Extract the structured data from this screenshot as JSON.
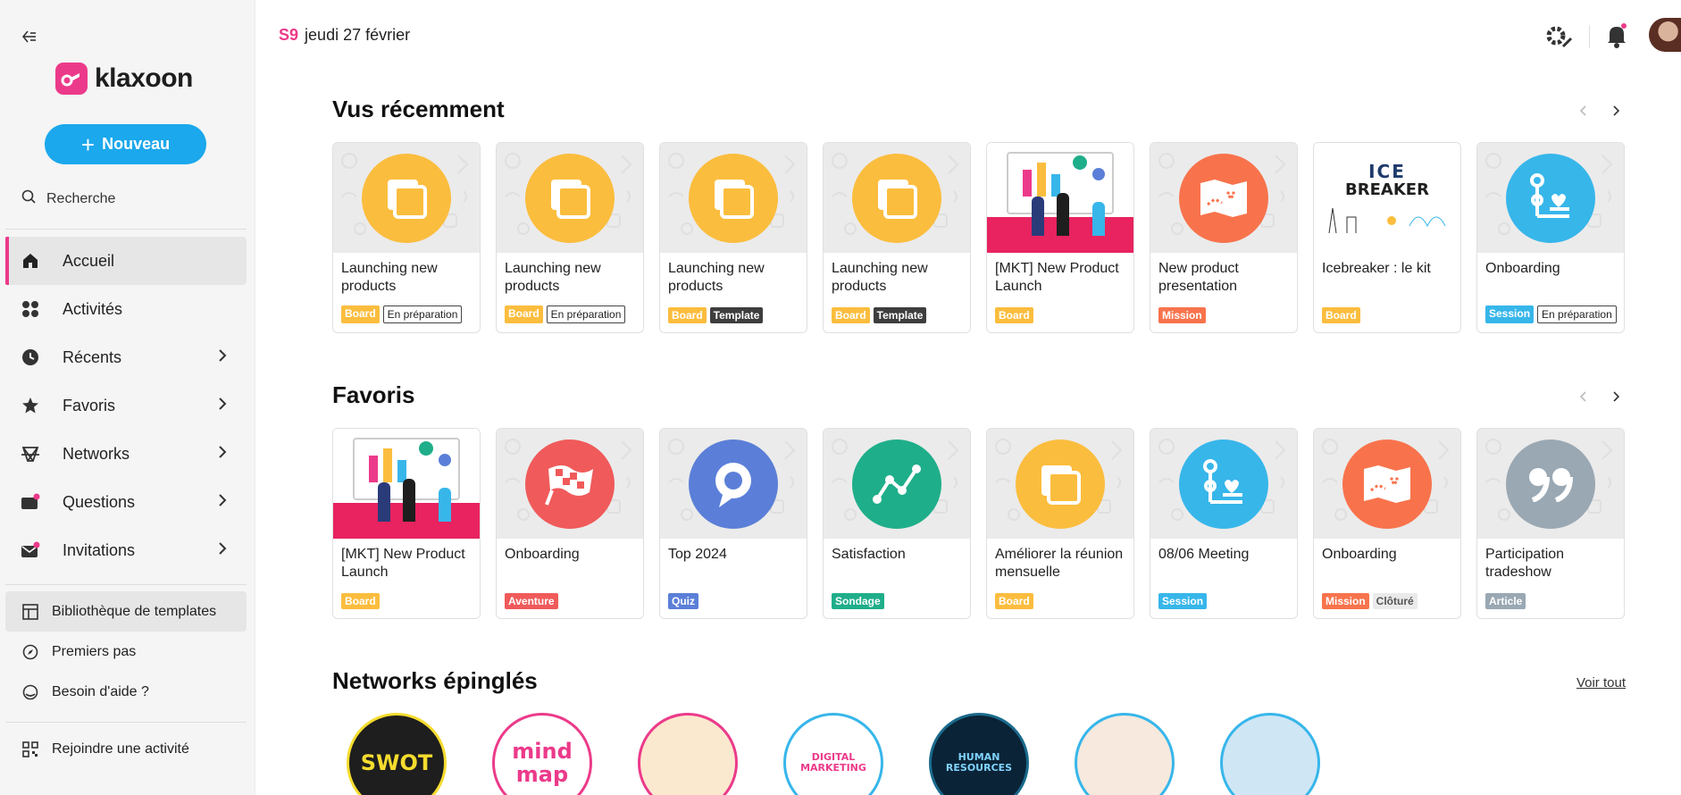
{
  "app": {
    "brand": "klaxoon",
    "accent": "#ec3a8a",
    "primary": "#1ba8ec"
  },
  "sidebar": {
    "new_button": "Nouveau",
    "search": "Recherche",
    "items": [
      {
        "label": "Accueil",
        "icon": "home-icon",
        "active": true
      },
      {
        "label": "Activités",
        "icon": "grid-icon"
      },
      {
        "label": "Récents",
        "icon": "clock-icon"
      },
      {
        "label": "Favoris",
        "icon": "star-icon"
      },
      {
        "label": "Networks",
        "icon": "network-icon"
      },
      {
        "label": "Questions",
        "icon": "questions-icon"
      },
      {
        "label": "Invitations",
        "icon": "mail-icon"
      }
    ],
    "bottom_items": [
      {
        "label": "Bibliothèque de templates",
        "icon": "template-icon"
      },
      {
        "label": "Premiers pas",
        "icon": "compass-icon"
      },
      {
        "label": "Besoin d'aide ?",
        "icon": "help-icon"
      }
    ],
    "join": {
      "label": "Rejoindre une activité",
      "icon": "qr-icon"
    }
  },
  "topbar": {
    "week": "S9",
    "date": "jeudi 27 février"
  },
  "recent": {
    "title": "Vus récemment",
    "cards": [
      {
        "title": "Launching new products",
        "thumb": "folder-icon",
        "color": "#fbbd3e",
        "tags": [
          {
            "label": "Board",
            "kind": "fill",
            "color": "#fbbd3e"
          },
          {
            "label": "En préparation",
            "kind": "outline"
          }
        ]
      },
      {
        "title": "Launching new products",
        "thumb": "folder-icon",
        "color": "#fbbd3e",
        "tags": [
          {
            "label": "Board",
            "kind": "fill",
            "color": "#fbbd3e"
          },
          {
            "label": "En préparation",
            "kind": "outline"
          }
        ]
      },
      {
        "title": "Launching new products",
        "thumb": "folder-icon",
        "color": "#fbbd3e",
        "tags": [
          {
            "label": "Board",
            "kind": "fill",
            "color": "#fbbd3e"
          },
          {
            "label": "Template",
            "kind": "dark"
          }
        ]
      },
      {
        "title": "Launching new products",
        "thumb": "folder-icon",
        "color": "#fbbd3e",
        "tags": [
          {
            "label": "Board",
            "kind": "fill",
            "color": "#fbbd3e"
          },
          {
            "label": "Template",
            "kind": "dark"
          }
        ]
      },
      {
        "title": "[MKT] New Product Launch",
        "thumb": "marketing-illustration",
        "color": "#ec3a8a",
        "tags": [
          {
            "label": "Board",
            "kind": "fill",
            "color": "#fbbd3e"
          }
        ]
      },
      {
        "title": "New product presentation",
        "thumb": "map-icon",
        "color": "#f8734c",
        "tags": [
          {
            "label": "Mission",
            "kind": "fill",
            "color": "#f8734c"
          }
        ]
      },
      {
        "title": "Icebreaker : le kit",
        "thumb": "icebreaker-illustration",
        "color": "#ffffff",
        "tags": [
          {
            "label": "Board",
            "kind": "fill",
            "color": "#fbbd3e"
          }
        ]
      },
      {
        "title": "Onboarding",
        "thumb": "session-icon",
        "color": "#37b6ea",
        "tags": [
          {
            "label": "Session",
            "kind": "fill",
            "color": "#37b6ea"
          },
          {
            "label": "En préparation",
            "kind": "outline"
          }
        ]
      }
    ]
  },
  "favorites": {
    "title": "Favoris",
    "cards": [
      {
        "title": "[MKT] New Product Launch",
        "thumb": "marketing-illustration",
        "color": "#ec3a8a",
        "tags": [
          {
            "label": "Board",
            "kind": "fill",
            "color": "#fbbd3e"
          }
        ]
      },
      {
        "title": "Onboarding",
        "thumb": "flag-icon",
        "color": "#f05a5a",
        "tags": [
          {
            "label": "Aventure",
            "kind": "fill",
            "color": "#f05a5a"
          }
        ]
      },
      {
        "title": "Top 2024",
        "thumb": "quiz-icon",
        "color": "#5b7fd8",
        "tags": [
          {
            "label": "Quiz",
            "kind": "fill",
            "color": "#5b7fd8"
          }
        ]
      },
      {
        "title": "Satisfaction",
        "thumb": "survey-icon",
        "color": "#1fae8a",
        "tags": [
          {
            "label": "Sondage",
            "kind": "fill",
            "color": "#1fae8a"
          }
        ]
      },
      {
        "title": "Améliorer la réunion mensuelle",
        "thumb": "folder-icon",
        "color": "#fbbd3e",
        "tags": [
          {
            "label": "Board",
            "kind": "fill",
            "color": "#fbbd3e"
          }
        ]
      },
      {
        "title": "08/06 Meeting",
        "thumb": "session-icon",
        "color": "#37b6ea",
        "tags": [
          {
            "label": "Session",
            "kind": "fill",
            "color": "#37b6ea"
          }
        ]
      },
      {
        "title": "Onboarding",
        "thumb": "map-icon",
        "color": "#f8734c",
        "tags": [
          {
            "label": "Mission",
            "kind": "fill",
            "color": "#f8734c"
          },
          {
            "label": "Clôturé",
            "kind": "grey"
          }
        ]
      },
      {
        "title": "Participation tradeshow",
        "thumb": "quote-icon",
        "color": "#9aa8b3",
        "tags": [
          {
            "label": "Article",
            "kind": "fill",
            "color": "#9aa8b3"
          }
        ]
      }
    ]
  },
  "networks": {
    "title": "Networks épinglés",
    "see_all": "Voir tout",
    "items": [
      {
        "name": "swot-network",
        "border": "#f5dc2e",
        "bg": "#1e1e1e",
        "text": "SWOT"
      },
      {
        "name": "mindmap-network",
        "border": "#ec3a8a",
        "bg": "#ffffff",
        "text": "mind map"
      },
      {
        "name": "pink-network",
        "border": "#ec3a8a",
        "bg": "#fbe9cf",
        "text": ""
      },
      {
        "name": "digital-marketing-network",
        "border": "#37b6ea",
        "bg": "#ffffff",
        "text": "DIGITAL MARKETING"
      },
      {
        "name": "human-resources-network",
        "border": "#1a6a8c",
        "bg": "#0b2336",
        "text": "HUMAN RESOURCES"
      },
      {
        "name": "team-network",
        "border": "#37b6ea",
        "bg": "#f7e9dd",
        "text": ""
      },
      {
        "name": "paris-network",
        "border": "#37b6ea",
        "bg": "#cfe6f5",
        "text": ""
      }
    ]
  }
}
